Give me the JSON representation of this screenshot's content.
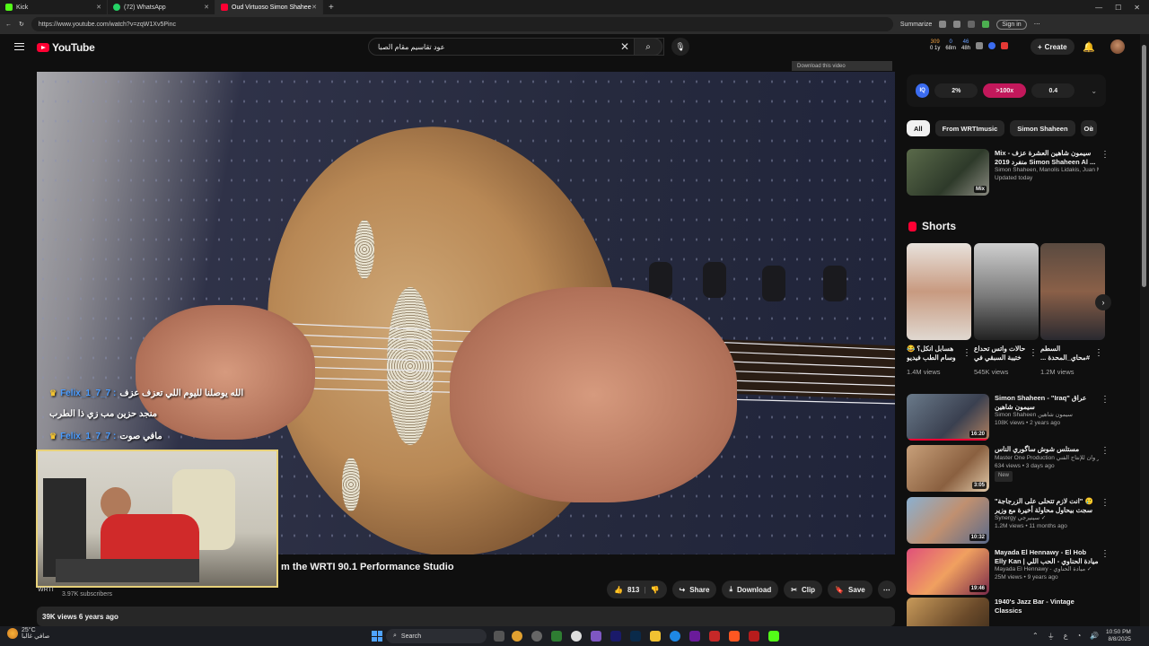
{
  "browser": {
    "tabs": [
      {
        "title": "Kick",
        "color": "#53fc18"
      },
      {
        "title": "(72) WhatsApp",
        "color": "#25d366"
      },
      {
        "title": "Oud Virtuoso Simon Shahee",
        "color": "#ff0033"
      }
    ],
    "new_tab": "+",
    "url": "https://www.youtube.com/watch?v=zqW1Xv5Pinc",
    "summarize": "Summarize",
    "sign_in": "Sign in"
  },
  "header": {
    "logo_text": "YouTube",
    "search_value": "عود تقاسيم مقام الصبا",
    "stats": [
      {
        "top": "309",
        "bottom": "0 1y"
      },
      {
        "top": "0",
        "bottom": "68m"
      },
      {
        "top": "46",
        "bottom": "48h"
      }
    ],
    "create_label": "Create"
  },
  "video": {
    "download_label": "Download this video",
    "chat": [
      {
        "user": "Felix_1_7_7 :",
        "msg": "الله يوصلنا لليوم اللي تعزف عزف"
      },
      {
        "user": "",
        "msg": "منجد حزين مب زي ذا الطرب"
      },
      {
        "user": "Felix_1_7_7 :",
        "msg": "مافي صوت"
      }
    ],
    "title_partial": "m the WRTI 90.1 Performance Studio",
    "channel_initials": "WRTI",
    "subscribers": "3.97K subscribers",
    "likes": "813",
    "share": "Share",
    "download": "Download",
    "clip": "Clip",
    "save": "Save",
    "more": "⋯",
    "views_line": "39K views  6 years ago"
  },
  "sidebar": {
    "miniplayer": {
      "iq": "IQ",
      "a": "2%",
      "b": ">100x",
      "c": "0.4"
    },
    "chips": [
      "All",
      "From WRTImusic",
      "Simon Shaheen",
      "Ou"
    ],
    "mix": {
      "title": "Mix - سيمون شاهين  العشرة عزف منفرد 2019 Simon Shaheen Al ...",
      "meta1": "Simon Shaheen, Manolis Lidakis, Juan M...",
      "meta2": "Updated today",
      "badge": "Mix"
    },
    "shorts_title": "Shorts",
    "shorts": [
      {
        "title": "هسابل انكل؟ 😂 وسام الطب فيديو",
        "views": "1.4M views"
      },
      {
        "title": "حالات واتس تحداع ختيبة السبقي في",
        "views": "545K views"
      },
      {
        "title": "السطم ‎#محاي_المحدة ...",
        "views": "1.2M views"
      }
    ],
    "videos": [
      {
        "title": "Simon Shaheen - \"Iraq\" عراق سيمون شاهين",
        "channel": "Simon Shaheen سيمون شاهين",
        "meta": "108K views • 2 years ago",
        "dur": "16:20",
        "badge": ""
      },
      {
        "title": "مستلس شوش ساگوري الناس",
        "channel": "Master One Production ماستر وان للإنتاج الفني",
        "meta": "634 views • 3 days ago",
        "dur": "3:05",
        "badge": "New"
      },
      {
        "title": "🥲 \"انت لازم تتحلى على الزرجاجة\" سجت بيحاول محاولة أخيرة مع وزير الداخلية",
        "channel": "Synergy سينيرجي ✓",
        "meta": "1.2M views • 11 months ago",
        "dur": "10:32",
        "badge": ""
      },
      {
        "title": "Mayada El Hennawy - El Hob Elly Kan | ميادة الحناوي - الحب اللي كان",
        "channel": "Mayada El Hennawy - ميادة الحناوي ✓",
        "meta": "25M views • 9 years ago",
        "dur": "19:46",
        "badge": ""
      },
      {
        "title": "1940's Jazz Bar - Vintage Classics",
        "channel": "",
        "meta": "",
        "dur": "",
        "badge": ""
      }
    ]
  },
  "taskbar": {
    "temp": "25°C",
    "weather_text": "صافي غالبا",
    "search": "Search",
    "time": "10:50 PM",
    "date": "8/8/2025",
    "lang": "ع"
  }
}
